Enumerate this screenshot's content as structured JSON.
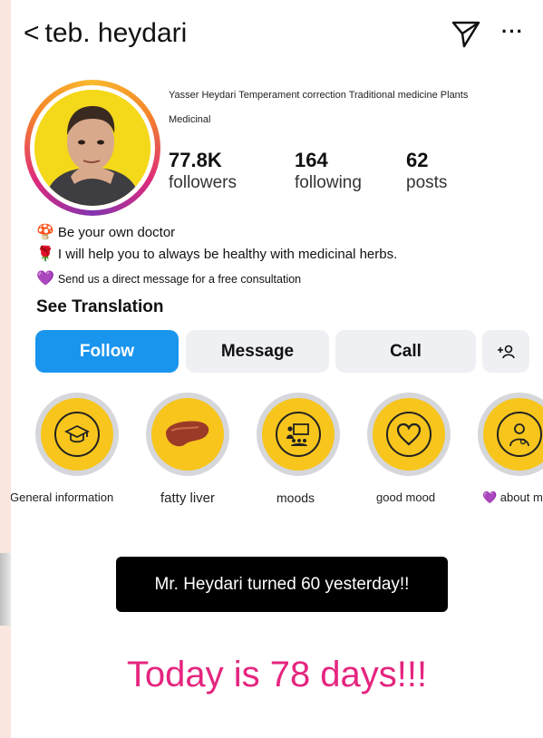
{
  "header": {
    "back_label": "<",
    "username": "teb. heydari",
    "send_icon": "send-icon",
    "more_label": "···"
  },
  "profile": {
    "name": "Yasser Heydari Temperament correction Traditional medicine Plants",
    "category": "Medicinal",
    "stats": [
      {
        "value": "77.8K",
        "label": "followers"
      },
      {
        "value": "164",
        "label": "following"
      },
      {
        "value": "62",
        "label": "posts"
      }
    ]
  },
  "bio": {
    "lines": [
      {
        "emoji": "🍄",
        "text": "Be your own doctor"
      },
      {
        "emoji": "🌹",
        "text": "I will help you to always be healthy with medicinal herbs."
      },
      {
        "emoji": "💜",
        "text": "Send us a direct message for a free consultation"
      }
    ],
    "see_translation": "See Translation"
  },
  "actions": {
    "follow": "Follow",
    "message": "Message",
    "call": "Call",
    "add_user": "+ዴ"
  },
  "highlights": [
    {
      "label": "General information",
      "icon": "graduation-cap-icon"
    },
    {
      "label": "fatty liver",
      "icon": "liver-icon"
    },
    {
      "label": "moods",
      "icon": "presentation-icon"
    },
    {
      "label": "good mood",
      "icon": "heart-icon"
    },
    {
      "label": "💜 about m",
      "icon": "doctor-icon"
    }
  ],
  "overlay": {
    "announcement": "Mr. Heydari turned 60 yesterday!!",
    "headline": "Today is 78 days!!!"
  },
  "colors": {
    "follow_blue": "#1a95ee",
    "headline_pink": "#e5257f",
    "highlight_yellow": "#f7c51c"
  }
}
